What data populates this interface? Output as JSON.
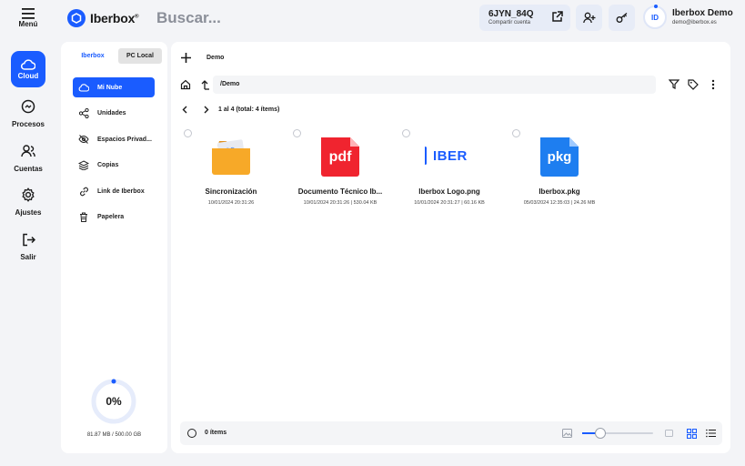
{
  "rail": {
    "menu_label": "Menú",
    "items": [
      {
        "label": "Cloud",
        "active": true
      },
      {
        "label": "Procesos",
        "active": false
      },
      {
        "label": "Cuentas",
        "active": false
      },
      {
        "label": "Ajustes",
        "active": false
      },
      {
        "label": "Salir",
        "active": false
      }
    ]
  },
  "header": {
    "logo_text": "Iberbox",
    "logo_reg": "®",
    "search_placeholder": "Buscar...",
    "share_code": "6JYN_84Q",
    "share_label": "Compartir cuenta",
    "avatar_initials": "ID",
    "user_name": "Iberbox Demo",
    "user_email": "demo@iberbox.es"
  },
  "nav": {
    "tab_cloud": "Iberbox",
    "tab_local": "PC Local",
    "items": [
      {
        "label": "Mi Nube",
        "icon": "cloud-icon",
        "active": true
      },
      {
        "label": "Unidades",
        "icon": "share-icon",
        "active": false
      },
      {
        "label": "Espacios Privad...",
        "icon": "eye-off-icon",
        "active": false
      },
      {
        "label": "Copias",
        "icon": "layers-icon",
        "active": false
      },
      {
        "label": "Link de Iberbox",
        "icon": "link-icon",
        "active": false
      },
      {
        "label": "Papelera",
        "icon": "trash-icon",
        "active": false
      }
    ],
    "usage_percent": 0,
    "usage_percent_label": "0%",
    "usage_text": "81.87 MB / 500.00 GB"
  },
  "main": {
    "tab_label": "Demo",
    "path": "/Demo",
    "pager_text": "1 al 4 (total: 4 ítems)",
    "files": [
      {
        "name": "Sincronización",
        "meta": "10/01/2024 20:31:26",
        "thumb": "folder-sync-icon",
        "color": "#f7a928"
      },
      {
        "name": "Documento Técnico Ib...",
        "meta": "10/01/2024 20:31:26 | 530.04 KB",
        "thumb": "pdf-file-icon",
        "color": "#f0242f",
        "thumb_text": "pdf"
      },
      {
        "name": "Iberbox Logo.png",
        "meta": "10/01/2024 20:31:27 | 60.16 KB",
        "thumb": "iberbox-logo-thumbnail",
        "color": "#1a5cff",
        "thumb_text": "IBER"
      },
      {
        "name": "Iberbox.pkg",
        "meta": "05/03/2024 12:35:03 | 24.26 MB",
        "thumb": "pkg-file-icon",
        "color": "#1e7ef0",
        "thumb_text": "pkg"
      }
    ],
    "selection_count": "0 ítems",
    "zoom_level": 0.25
  },
  "colors": {
    "accent": "#1a5cff",
    "surface": "#ffffff",
    "background": "#f3f4f7"
  }
}
